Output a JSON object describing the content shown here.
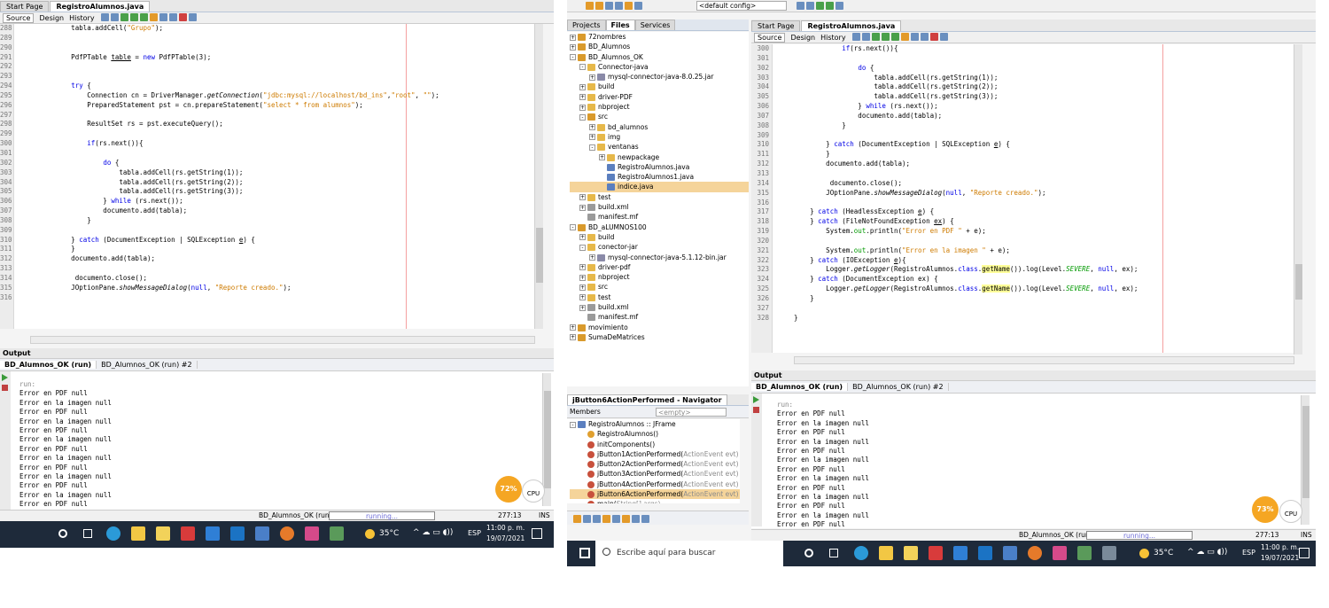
{
  "left": {
    "editor_tabs": [
      "Start Page",
      "RegistroAlumnos.java"
    ],
    "subtabs": [
      "Source",
      "Design",
      "History"
    ],
    "line_numbers": [
      "288",
      "289",
      "290",
      "291",
      "292",
      "293",
      "294",
      "295",
      "296",
      "297",
      "298",
      "299",
      "300",
      "301",
      "302",
      "303",
      "304",
      "305",
      "306",
      "307",
      "308",
      "309",
      "310",
      "311",
      "312",
      "313",
      "314",
      "315",
      "316"
    ],
    "output_title": "Output",
    "output_tabs": [
      "BD_Alumnos_OK (run)",
      "BD_Alumnos_OK (run) #2"
    ],
    "output_lines": [
      "run:",
      "Error en PDF null",
      "Error en la imagen null",
      "Error en PDF null",
      "Error en la imagen null",
      "Error en PDF null",
      "Error en la imagen null",
      "Error en PDF null",
      "Error en la imagen null",
      "Error en PDF null",
      "Error en la imagen null",
      "Error en PDF null",
      "Error en la imagen null",
      "Error en PDF null"
    ],
    "cpu_percent": "72%",
    "cpu_label": "CPU",
    "status_project": "BD_Alumnos_OK (run)",
    "status_running": "running...",
    "status_pos": "277:13",
    "status_mode": "INS",
    "tray_temp": "35°C",
    "tray_lang": "ESP",
    "tray_time": "11:00 p. m.",
    "tray_date": "19/07/2021"
  },
  "right": {
    "config": "<default config>",
    "panel_tabs": [
      "Projects",
      "Files",
      "Services"
    ],
    "tree": [
      {
        "label": "72nombres",
        "type": "proj",
        "indent": 0,
        "fold": "+"
      },
      {
        "label": "BD_Alumnos",
        "type": "proj",
        "indent": 0,
        "fold": "+"
      },
      {
        "label": "BD_Alumnos_OK",
        "type": "proj",
        "indent": 0,
        "fold": "-"
      },
      {
        "label": "Connector-java",
        "type": "folder",
        "indent": 1,
        "fold": "-"
      },
      {
        "label": "mysql-connector-java-8.0.25.jar",
        "type": "jar",
        "indent": 2,
        "fold": "+"
      },
      {
        "label": "build",
        "type": "folder",
        "indent": 1,
        "fold": "+"
      },
      {
        "label": "driver-PDF",
        "type": "folder",
        "indent": 1,
        "fold": "+"
      },
      {
        "label": "nbproject",
        "type": "folder",
        "indent": 1,
        "fold": "+"
      },
      {
        "label": "src",
        "type": "proj",
        "indent": 1,
        "fold": "-"
      },
      {
        "label": "bd_alumnos",
        "type": "folder",
        "indent": 2,
        "fold": "+"
      },
      {
        "label": "img",
        "type": "folder",
        "indent": 2,
        "fold": "+"
      },
      {
        "label": "ventanas",
        "type": "folder",
        "indent": 2,
        "fold": "-"
      },
      {
        "label": "newpackage",
        "type": "folder",
        "indent": 3,
        "fold": "+"
      },
      {
        "label": "RegistroAlumnos.java",
        "type": "java",
        "indent": 3,
        "fold": ""
      },
      {
        "label": "RegistroAlumnos1.java",
        "type": "java",
        "indent": 3,
        "fold": ""
      },
      {
        "label": "indice.java",
        "type": "java",
        "indent": 3,
        "fold": "",
        "selected": true
      },
      {
        "label": "test",
        "type": "folder",
        "indent": 1,
        "fold": "+"
      },
      {
        "label": "build.xml",
        "type": "xml",
        "indent": 1,
        "fold": "+"
      },
      {
        "label": "manifest.mf",
        "type": "xml",
        "indent": 1,
        "fold": ""
      },
      {
        "label": "BD_aLUMNOS100",
        "type": "proj",
        "indent": 0,
        "fold": "-"
      },
      {
        "label": "build",
        "type": "folder",
        "indent": 1,
        "fold": "+"
      },
      {
        "label": "conector-jar",
        "type": "folder",
        "indent": 1,
        "fold": "-"
      },
      {
        "label": "mysql-connector-java-5.1.12-bin.jar",
        "type": "jar",
        "indent": 2,
        "fold": "+"
      },
      {
        "label": "driver-pdf",
        "type": "folder",
        "indent": 1,
        "fold": "+"
      },
      {
        "label": "nbproject",
        "type": "folder",
        "indent": 1,
        "fold": "+"
      },
      {
        "label": "src",
        "type": "folder",
        "indent": 1,
        "fold": "+"
      },
      {
        "label": "test",
        "type": "folder",
        "indent": 1,
        "fold": "+"
      },
      {
        "label": "build.xml",
        "type": "xml",
        "indent": 1,
        "fold": "+"
      },
      {
        "label": "manifest.mf",
        "type": "xml",
        "indent": 1,
        "fold": ""
      },
      {
        "label": "movimiento",
        "type": "proj",
        "indent": 0,
        "fold": "+"
      },
      {
        "label": "SumaDeMatrices",
        "type": "proj",
        "indent": 0,
        "fold": "+"
      }
    ],
    "navigator_title": "jButton6ActionPerformed - Navigator",
    "navigator_members": "Members",
    "navigator_filter": "<empty>",
    "navigator_items": [
      {
        "label": "RegistroAlumnos :: JFrame",
        "type": "java",
        "indent": 0,
        "fold": "-"
      },
      {
        "label": "RegistroAlumnos()",
        "type": "ctor",
        "indent": 1
      },
      {
        "label": "initComponents()",
        "type": "method",
        "indent": 1
      },
      {
        "label": "jButton1ActionPerformed(",
        "suffix": "ActionEvent evt)",
        "type": "method",
        "indent": 1
      },
      {
        "label": "jButton2ActionPerformed(",
        "suffix": "ActionEvent evt)",
        "type": "method",
        "indent": 1
      },
      {
        "label": "jButton3ActionPerformed(",
        "suffix": "ActionEvent evt)",
        "type": "method",
        "indent": 1
      },
      {
        "label": "jButton4ActionPerformed(",
        "suffix": "ActionEvent evt)",
        "type": "method",
        "indent": 1
      },
      {
        "label": "jButton6ActionPerformed(",
        "suffix": "ActionEvent evt)",
        "type": "method",
        "indent": 1,
        "selected": true
      },
      {
        "label": "main(",
        "suffix": "String[] args)",
        "type": "method",
        "indent": 1
      }
    ],
    "editor_tabs": [
      "Start Page",
      "RegistroAlumnos.java"
    ],
    "subtabs": [
      "Source",
      "Design",
      "History"
    ],
    "line_numbers": [
      "300",
      "301",
      "302",
      "303",
      "304",
      "305",
      "306",
      "307",
      "308",
      "309",
      "310",
      "311",
      "312",
      "313",
      "314",
      "315",
      "316",
      "317",
      "318",
      "319",
      "320",
      "321",
      "322",
      "323",
      "324",
      "325",
      "326",
      "327",
      "328"
    ],
    "output_title": "Output",
    "output_tabs": [
      "BD_Alumnos_OK (run)",
      "BD_Alumnos_OK (run) #2"
    ],
    "output_lines": [
      "run:",
      "Error en PDF null",
      "Error en la imagen null",
      "Error en PDF null",
      "Error en la imagen null",
      "Error en PDF null",
      "Error en la imagen null",
      "Error en PDF null",
      "Error en la imagen null",
      "Error en PDF null",
      "Error en la imagen null",
      "Error en PDF null",
      "Error en la imagen null",
      "Error en PDF null"
    ],
    "cpu_percent": "73%",
    "cpu_label": "CPU",
    "status_project": "BD_Alumnos_OK (run)",
    "status_running": "running...",
    "status_pos": "277:13",
    "status_mode": "INS",
    "search_placeholder": "Escribe aquí para buscar",
    "tray_temp": "35°C",
    "tray_lang": "ESP",
    "tray_time": "11:00 p. m.",
    "tray_date": "19/07/2021"
  },
  "colors": {
    "keyword": "#0000e6",
    "string": "#ce7b00",
    "field": "#009900",
    "taskbar": "#1e2a3a",
    "cpu": "#f5a623"
  }
}
